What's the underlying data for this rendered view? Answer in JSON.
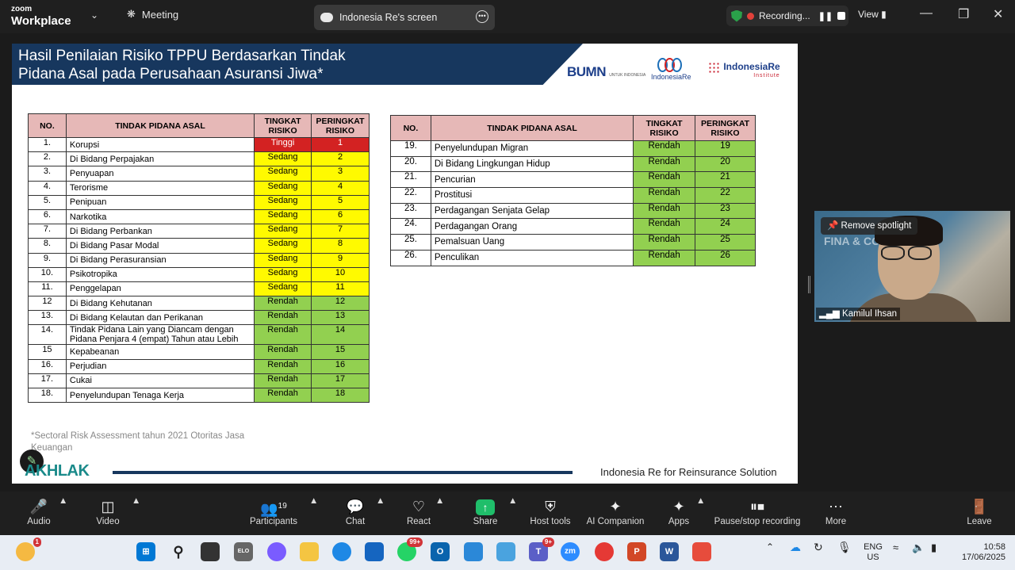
{
  "topbar": {
    "logo_line1": "zoom",
    "logo_line2": "Workplace",
    "meeting_label": "Meeting",
    "share_tab_label": "Indonesia Re's screen",
    "recording_label": "Recording...",
    "view_label": "View"
  },
  "slide": {
    "title": "Hasil Penilaian Risiko TPPU Berdasarkan Tindak Pidana Asal pada Perusahaan Asuransi Jiwa*",
    "logos": {
      "bumn": "BUMN",
      "bumn_sub": "UNTUK INDONESIA",
      "indonesiare": "IndonesiaRe",
      "institute": "IndonesiaRe",
      "institute_sub": "Institute"
    },
    "table_headers": {
      "no": "NO.",
      "tindak": "TINDAK PIDANA ASAL",
      "tingkat_line1": "TINGKAT",
      "tingkat_line2": "RISIKO",
      "peringkat_line1": "PERINGKAT",
      "peringkat_line2": "RISIKO"
    },
    "table_left": [
      {
        "no": "1.",
        "name": "Korupsi",
        "level": "Tinggi",
        "rank": "1"
      },
      {
        "no": "2.",
        "name": "Di Bidang Perpajakan",
        "level": "Sedang",
        "rank": "2"
      },
      {
        "no": "3.",
        "name": "Penyuapan",
        "level": "Sedang",
        "rank": "3"
      },
      {
        "no": "4.",
        "name": "Terorisme",
        "level": "Sedang",
        "rank": "4"
      },
      {
        "no": "5.",
        "name": "Penipuan",
        "level": "Sedang",
        "rank": "5"
      },
      {
        "no": "6.",
        "name": "Narkotika",
        "level": "Sedang",
        "rank": "6"
      },
      {
        "no": "7.",
        "name": "Di Bidang Perbankan",
        "level": "Sedang",
        "rank": "7"
      },
      {
        "no": "8.",
        "name": "Di Bidang Pasar Modal",
        "level": "Sedang",
        "rank": "8"
      },
      {
        "no": "9.",
        "name": "Di Bidang Perasuransian",
        "level": "Sedang",
        "rank": "9"
      },
      {
        "no": "10.",
        "name": "Psikotropika",
        "level": "Sedang",
        "rank": "10"
      },
      {
        "no": "11.",
        "name": "Penggelapan",
        "level": "Sedang",
        "rank": "11"
      },
      {
        "no": "12",
        "name": "Di Bidang Kehutanan",
        "level": "Rendah",
        "rank": "12"
      },
      {
        "no": "13.",
        "name": "Di Bidang Kelautan dan Perikanan",
        "level": "Rendah",
        "rank": "13"
      },
      {
        "no": "14.",
        "name": "Tindak Pidana Lain yang Diancam dengan Pidana Penjara 4 (empat) Tahun atau Lebih",
        "level": "Rendah",
        "rank": "14"
      },
      {
        "no": "15",
        "name": "Kepabeanan",
        "level": "Rendah",
        "rank": "15"
      },
      {
        "no": "16.",
        "name": "Perjudian",
        "level": "Rendah",
        "rank": "16"
      },
      {
        "no": "17.",
        "name": "Cukai",
        "level": "Rendah",
        "rank": "17"
      },
      {
        "no": "18.",
        "name": "Penyelundupan Tenaga Kerja",
        "level": "Rendah",
        "rank": "18"
      }
    ],
    "table_right": [
      {
        "no": "19.",
        "name": "Penyelundupan Migran",
        "level": "Rendah",
        "rank": "19"
      },
      {
        "no": "20.",
        "name": "Di Bidang Lingkungan Hidup",
        "level": "Rendah",
        "rank": "20"
      },
      {
        "no": "21.",
        "name": "Pencurian",
        "level": "Rendah",
        "rank": "21"
      },
      {
        "no": "22.",
        "name": "Prostitusi",
        "level": "Rendah",
        "rank": "22"
      },
      {
        "no": "23.",
        "name": "Perdagangan Senjata Gelap",
        "level": "Rendah",
        "rank": "23"
      },
      {
        "no": "24.",
        "name": "Perdagangan Orang",
        "level": "Rendah",
        "rank": "24"
      },
      {
        "no": "25.",
        "name": "Pemalsuan Uang",
        "level": "Rendah",
        "rank": "25"
      },
      {
        "no": "26.",
        "name": "Penculikan",
        "level": "Rendah",
        "rank": "26"
      }
    ],
    "footnote": "*Sectoral Risk Assessment  tahun 2021  Otoritas Jasa Keuangan",
    "brand": "AKHLAK",
    "tagline": "Indonesia Re for Reinsurance Solution"
  },
  "video": {
    "spotlight_label": "Remove spotlight",
    "participant_name": "Kamilul Ihsan",
    "bg_text": "FINA & CO"
  },
  "toolbar": {
    "audio": "Audio",
    "video": "Video",
    "participants": "Participants",
    "participants_count": "19",
    "chat": "Chat",
    "react": "React",
    "share": "Share",
    "host_tools": "Host tools",
    "ai_companion": "AI Companion",
    "apps": "Apps",
    "pause_recording": "Pause/stop recording",
    "more": "More",
    "leave": "Leave"
  },
  "taskbar": {
    "weather_badge": "1",
    "whatsapp_badge": "99+",
    "teams_badge": "9+",
    "lang_line1": "ENG",
    "lang_line2": "US",
    "time": "10:58",
    "date": "17/06/2025"
  }
}
